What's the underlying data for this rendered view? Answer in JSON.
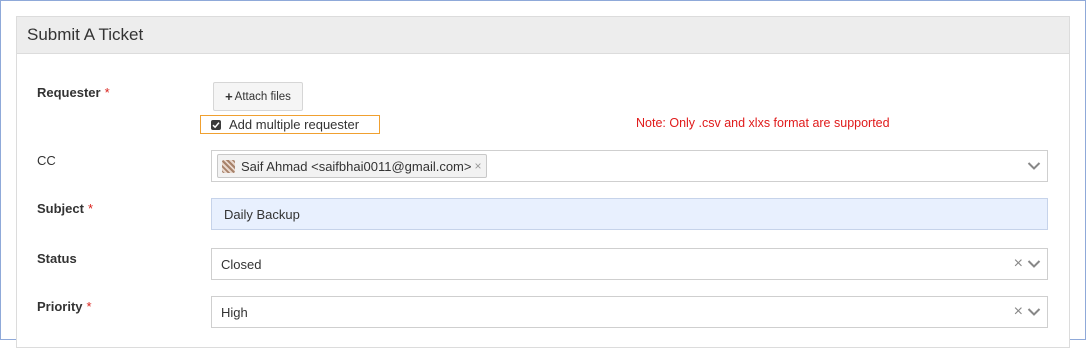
{
  "panel": {
    "title": "Submit A Ticket"
  },
  "requester": {
    "label": "Requester",
    "required_mark": "*",
    "attach_button": "Attach files",
    "multi_checkbox_label": "Add multiple requester",
    "multi_checked": true,
    "note": "Note: Only .csv and xlxs format are supported"
  },
  "cc": {
    "label": "CC",
    "tag_text": "Saif Ahmad <saifbhai0011@gmail.com>",
    "tag_remove": "×"
  },
  "subject": {
    "label": "Subject",
    "required_mark": "*",
    "value": "Daily Backup"
  },
  "status": {
    "label": "Status",
    "value": "Closed",
    "clear": "×"
  },
  "priority": {
    "label": "Priority",
    "required_mark": "*",
    "value": "High",
    "clear": "×"
  },
  "colors": {
    "required": "#d9221c",
    "note": "#e01a1a",
    "highlight_border": "#f0a030",
    "subject_bg": "#e8f0fe"
  }
}
